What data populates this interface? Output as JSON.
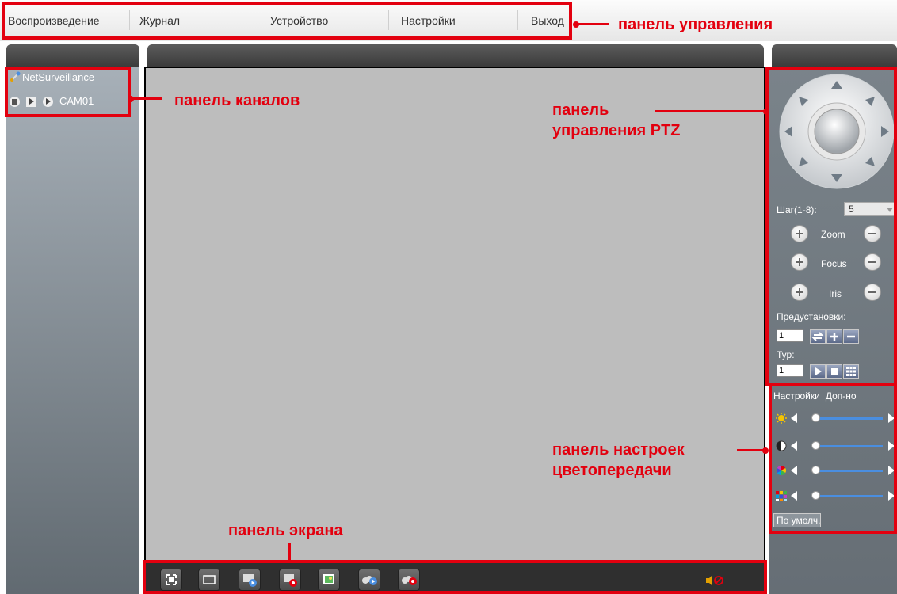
{
  "menu": {
    "items": [
      {
        "label": "Воспроизведение"
      },
      {
        "label": "Журнал"
      },
      {
        "label": "Устройство"
      },
      {
        "label": "Настройки"
      },
      {
        "label": "Выход"
      }
    ]
  },
  "channels": {
    "root_label": "NetSurveillance",
    "camera_label": "CAM01"
  },
  "ptz": {
    "step_label": "Шаг(1-8):",
    "step_value": "5",
    "zoom_label": "Zoom",
    "focus_label": "Focus",
    "iris_label": "Iris",
    "presets_label": "Предустановки:",
    "preset_value": "1",
    "tour_label": "Тур:",
    "tour_value": "1"
  },
  "color": {
    "tab_settings": "Настройки",
    "tab_extra": "Доп-но",
    "default_button": "По умолч."
  },
  "annotations": {
    "control_panel": "панель управления",
    "channel_panel": "панель каналов",
    "ptz_panel_line1": "панель",
    "ptz_panel_line2": "управления PTZ",
    "color_panel_line1": "панель настроек",
    "color_panel_line2": "цветопередачи",
    "screen_panel": "панель экрана"
  },
  "colors": {
    "annotation_red": "#e3000f",
    "panel_dark": "#3b3b3b",
    "video_gray": "#bdbdbd"
  }
}
